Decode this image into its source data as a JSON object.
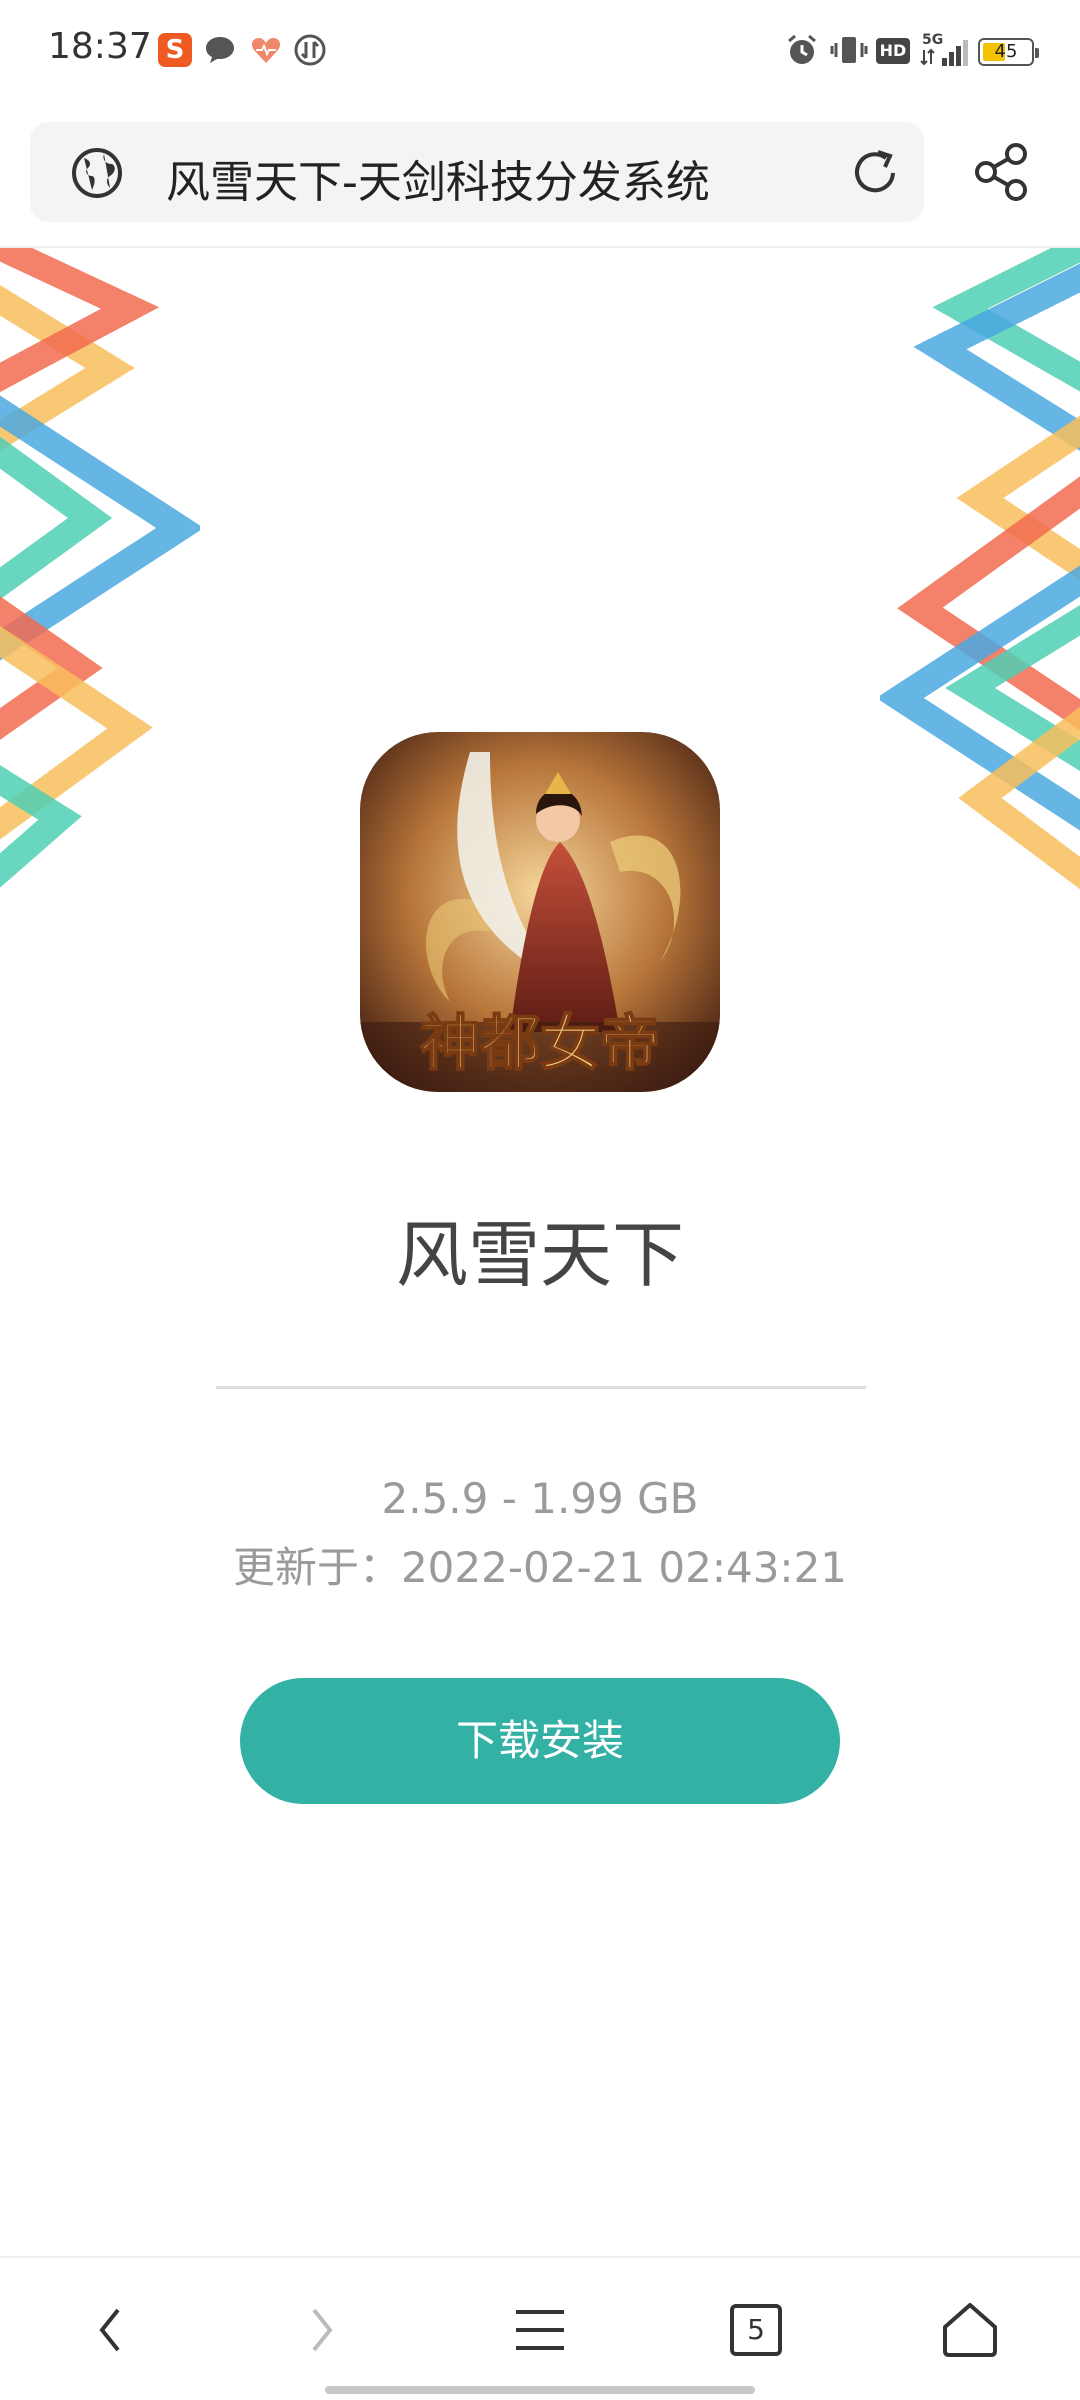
{
  "status_bar": {
    "time": "18:37",
    "icons": [
      "sogou-icon",
      "chat-icon",
      "health-icon",
      "data-icon",
      "alarm-icon",
      "vibrate-icon",
      "hd-icon",
      "5g-signal-icon",
      "battery-icon"
    ],
    "hd_label": "HD",
    "network_label": "5G",
    "battery_level": "45"
  },
  "browser": {
    "page_title": "风雪天下-天剑科技分发系统",
    "icons": [
      "globe-icon",
      "reload-icon",
      "share-icon"
    ]
  },
  "app": {
    "name": "风雪天下",
    "version_size": "2.5.9 - 1.99 GB",
    "updated": "更新于：2022-02-21 02:43:21",
    "icon_caption": "神都女帝",
    "install_label": "下载安装",
    "accent_color": "#34b1a5"
  },
  "bottom_nav": {
    "items": [
      "back-icon",
      "forward-icon",
      "menu-icon",
      "tabs-icon",
      "home-icon"
    ],
    "tab_count": "5"
  },
  "decoration_colors": [
    "#f26b50",
    "#f8be5c",
    "#4fcfb4",
    "#4aa8e0"
  ]
}
